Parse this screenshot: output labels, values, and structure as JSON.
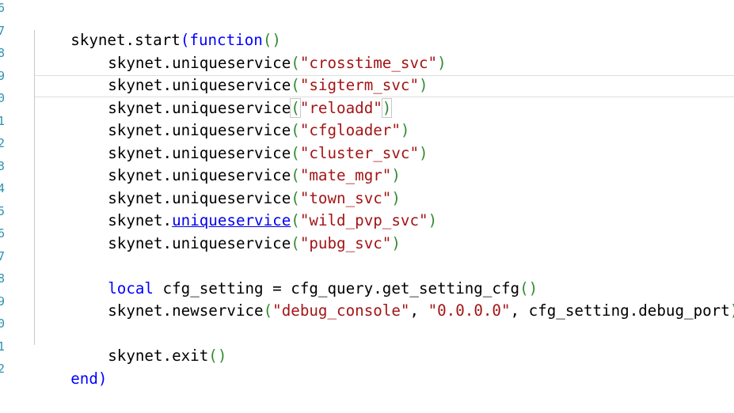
{
  "colors": {
    "keyword": "#0000ff",
    "string": "#a31515",
    "paren": "#318a31",
    "text": "#000000",
    "line_number": "#2b91af",
    "link": "#0000ee",
    "background": "#ffffff"
  },
  "gutter": {
    "line_numbers": [
      "6",
      "7",
      "8",
      "9",
      "0",
      "1",
      "2",
      "3",
      "4",
      "5",
      "6",
      "7",
      "8",
      "9",
      "0",
      "1",
      "2"
    ]
  },
  "code": {
    "l1": {
      "a": "skynet.start",
      "b": "(",
      "kw": "function",
      "c": "()"
    },
    "svc_prefix": "skynet.uniqueservice",
    "open": "(",
    "close": ")",
    "services": [
      "\"crosstime_svc\"",
      "\"sigterm_svc\"",
      "\"reloadd\"",
      "\"cfgloader\"",
      "\"cluster_svc\"",
      "\"mate_mgr\"",
      "\"town_svc\"",
      "\"wild_pvp_svc\"",
      "\"pubg_svc\""
    ],
    "link_text": "uniqueservice",
    "skynet_dot": "skynet.",
    "local_line": {
      "kw": "local",
      "rest": " cfg_setting = cfg_query.get_setting_cfg",
      "paren": "()"
    },
    "newservice_line": {
      "a": "skynet.newservice",
      "s1": "\"debug_console\"",
      "sep1": ", ",
      "s2": "\"0.0.0.0\"",
      "sep2": ", cfg_setting.debug_port"
    },
    "exit_line": {
      "a": "skynet.exit",
      "paren": "()"
    },
    "end_line": {
      "kw": "end",
      "paren": ")"
    }
  }
}
